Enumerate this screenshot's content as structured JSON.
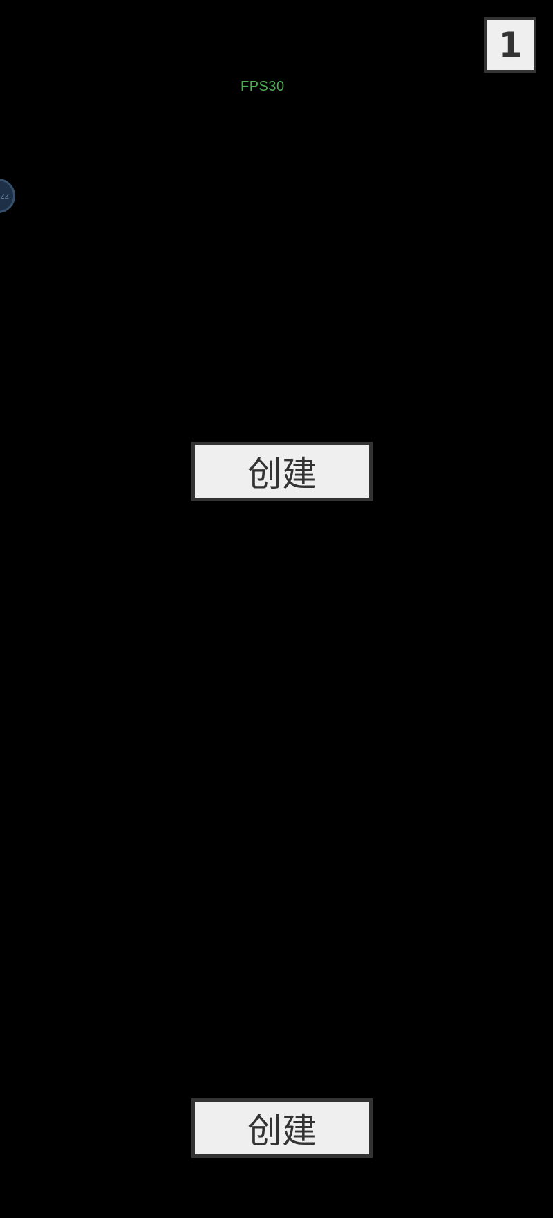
{
  "hud": {
    "fps_text": "FPS30",
    "counter": "1",
    "bubble_text": "zz"
  },
  "buttons": {
    "create_top_label": "创建",
    "create_bottom_label": "创建"
  },
  "colors": {
    "background": "#000000",
    "fps": "#4caf50",
    "button_bg": "#efefef",
    "button_border": "#333333",
    "bubble_bg": "#1d3047"
  }
}
